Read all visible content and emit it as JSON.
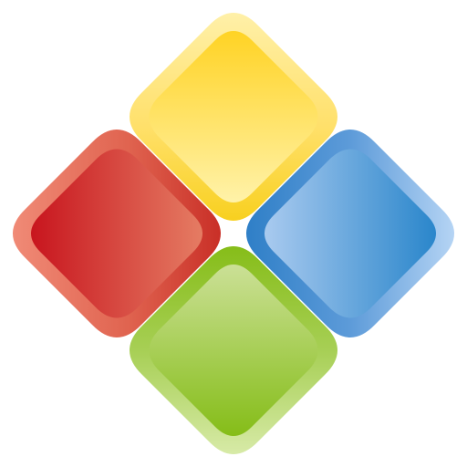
{
  "logo": {
    "tiles": [
      {
        "name": "yellow",
        "outer": "#f5d44a",
        "border_light": "#fff0a8",
        "inner_top": "#ffd221",
        "inner_bottom": "#fff0a6"
      },
      {
        "name": "red",
        "outer": "#d94a3a",
        "border_light": "#f08a76",
        "inner_left": "#c8151e",
        "inner_right": "#e47a62"
      },
      {
        "name": "blue",
        "outer": "#4f91d3",
        "border_light": "#a9cdf1",
        "inner_left": "#a8c9ee",
        "inner_right": "#2a86cb"
      },
      {
        "name": "green",
        "outer": "#93c53d",
        "border_light": "#d5e9a4",
        "inner_top": "#c9df92",
        "inner_bottom": "#85bd18"
      }
    ]
  }
}
